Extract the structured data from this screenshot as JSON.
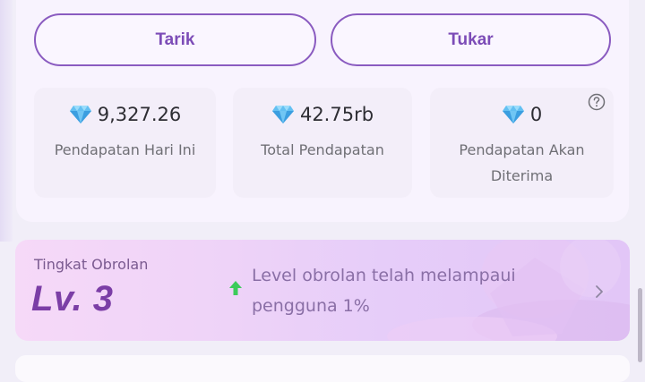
{
  "actions": {
    "withdraw_label": "Tarik",
    "exchange_label": "Tukar"
  },
  "stats": [
    {
      "value": "9,327.26",
      "label": "Pendapatan Hari Ini",
      "icon": "diamond-icon"
    },
    {
      "value": "42.75rb",
      "label": "Total Pendapatan",
      "icon": "diamond-icon"
    },
    {
      "value": "0",
      "label": "Pendapatan Akan Diterima",
      "icon": "diamond-icon"
    }
  ],
  "help_icon": "question-circle-icon",
  "chat_level": {
    "title": "Tingkat Obrolan",
    "value": "Lv. 3",
    "description": "Level obrolan telah melampaui pengguna 1%"
  },
  "colors": {
    "accent": "#7c4cb7",
    "level_text": "#7b3ea6",
    "up_arrow": "#3ccb5a",
    "diamond": "#5ab6ee"
  }
}
